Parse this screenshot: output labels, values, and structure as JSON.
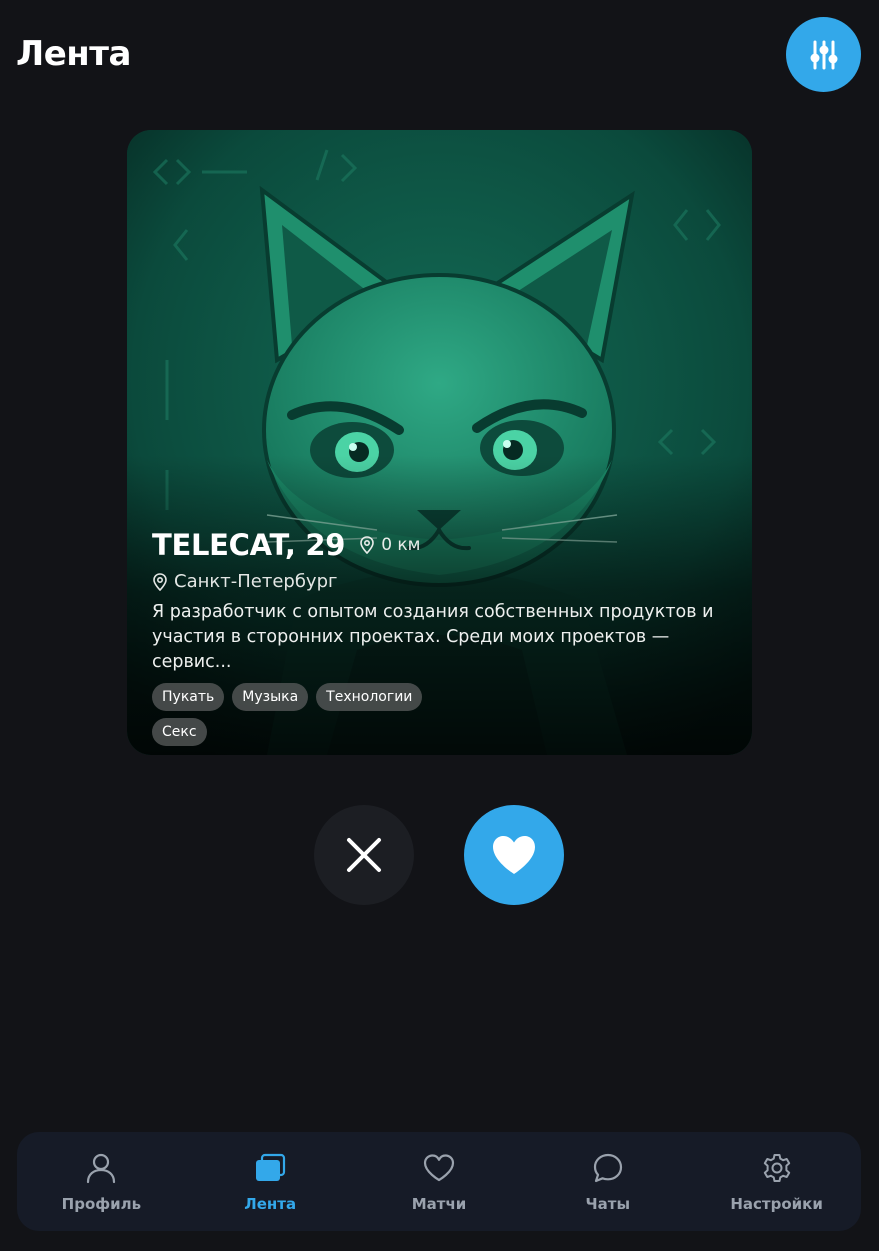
{
  "header": {
    "title": "Лента",
    "filter_icon": "sliders-icon"
  },
  "profile_card": {
    "name_age": "TELECAT, 29",
    "distance": "0 км",
    "city": "Санкт-Петербург",
    "bio": "Я разработчик с опытом создания собственных продуктов и участия в сторонних проектах. Среди моих проектов — сервис...",
    "tags": [
      "Пукать",
      "Музыка",
      "Технологии",
      "Секс"
    ]
  },
  "actions": {
    "dislike_icon": "close-icon",
    "like_icon": "heart-icon"
  },
  "nav": {
    "items": [
      {
        "label": "Профиль",
        "icon": "user-icon",
        "active": false
      },
      {
        "label": "Лента",
        "icon": "cards-icon",
        "active": true
      },
      {
        "label": "Матчи",
        "icon": "heart-outline-icon",
        "active": false
      },
      {
        "label": "Чаты",
        "icon": "chat-bubble-icon",
        "active": false
      },
      {
        "label": "Настройки",
        "icon": "gear-icon",
        "active": false
      }
    ]
  },
  "colors": {
    "background": "#121317",
    "accent": "#33a8ea",
    "nav_background": "#161b27",
    "nav_inactive": "#9aa2ad"
  }
}
